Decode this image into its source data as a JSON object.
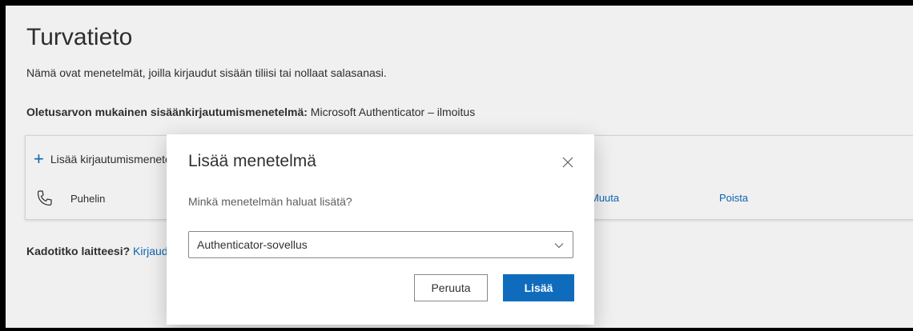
{
  "page": {
    "title": "Turvatieto",
    "description": "Nämä ovat menetelmät, joilla kirjaudut sisään tiliisi tai nollaat salasanasi.",
    "default_method_label": "Oletusarvon mukainen sisäänkirjautumismenetelmä:",
    "default_method_value": " Microsoft Authenticator – ilmoitus",
    "add_method_label": "Lisää kirjautumismenetelmä",
    "methods": [
      {
        "name": "Puhelin",
        "action1": "Muuta",
        "action2": "Poista"
      }
    ],
    "lost_device_label": "Kadotitko laitteesi?",
    "lost_device_link": " Kirjaudu ulos kaikkialta"
  },
  "dialog": {
    "title": "Lisää menetelmä",
    "question": "Minkä menetelmän haluat lisätä?",
    "select_value": "Authenticator-sovellus",
    "cancel_label": "Peruuta",
    "add_label": "Lisää"
  },
  "colors": {
    "accent": "#0f6cbd",
    "text": "#323130"
  }
}
